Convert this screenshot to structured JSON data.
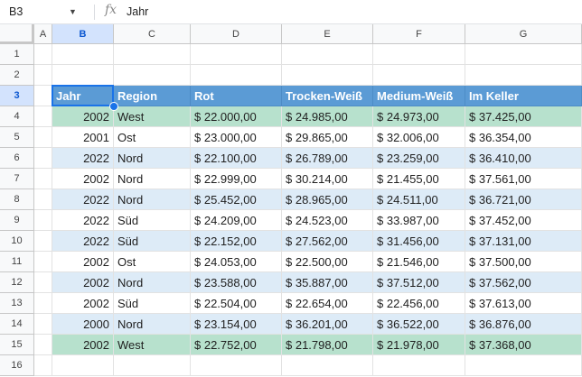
{
  "formula_bar": {
    "name_box": "B3",
    "fx_symbol": "fx",
    "value": "Jahr"
  },
  "columns": [
    "A",
    "B",
    "C",
    "D",
    "E",
    "F",
    "G"
  ],
  "row_numbers": [
    "1",
    "2",
    "3",
    "4",
    "5",
    "6",
    "7",
    "8",
    "9",
    "10",
    "11",
    "12",
    "13",
    "14",
    "15",
    "16"
  ],
  "table": {
    "headers": [
      "Jahr",
      "Region",
      "Rot",
      "Trocken-Weiß",
      "Medium-Weiß",
      "Im Keller"
    ],
    "rows": [
      [
        "2002",
        "West",
        "$ 22.000,00",
        "$ 24.985,00",
        "$ 24.973,00",
        "$ 37.425,00"
      ],
      [
        "2001",
        "Ost",
        "$ 23.000,00",
        "$ 29.865,00",
        "$ 32.006,00",
        "$ 36.354,00"
      ],
      [
        "2022",
        "Nord",
        "$ 22.100,00",
        "$ 26.789,00",
        "$ 23.259,00",
        "$ 36.410,00"
      ],
      [
        "2002",
        "Nord",
        "$ 22.999,00",
        "$ 30.214,00",
        "$ 21.455,00",
        "$ 37.561,00"
      ],
      [
        "2022",
        "Nord",
        "$ 25.452,00",
        "$ 28.965,00",
        "$ 24.511,00",
        "$ 36.721,00"
      ],
      [
        "2022",
        "Süd",
        "$ 24.209,00",
        "$ 24.523,00",
        "$ 33.987,00",
        "$ 37.452,00"
      ],
      [
        "2022",
        "Süd",
        "$ 22.152,00",
        "$ 27.562,00",
        "$ 31.456,00",
        "$ 37.131,00"
      ],
      [
        "2002",
        "Ost",
        "$ 24.053,00",
        "$ 22.500,00",
        "$ 21.546,00",
        "$ 37.500,00"
      ],
      [
        "2002",
        "Nord",
        "$ 23.588,00",
        "$ 35.887,00",
        "$ 37.512,00",
        "$ 37.562,00"
      ],
      [
        "2002",
        "Süd",
        "$ 22.504,00",
        "$ 22.654,00",
        "$ 22.456,00",
        "$ 37.613,00"
      ],
      [
        "2000",
        "Nord",
        "$ 23.154,00",
        "$ 36.201,00",
        "$ 36.522,00",
        "$ 36.876,00"
      ],
      [
        "2002",
        "West",
        "$ 22.752,00",
        "$ 21.798,00",
        "$ 21.978,00",
        "$ 37.368,00"
      ]
    ],
    "highlight_rows": [
      0,
      11
    ]
  },
  "colors": {
    "header_bg": "#5b9bd5",
    "band_light": "#ffffff",
    "band_dark": "#ddebf7",
    "highlight_green": "#b7e1cd",
    "selection_blue": "#1a73e8"
  },
  "selection": {
    "cell": "B3"
  }
}
